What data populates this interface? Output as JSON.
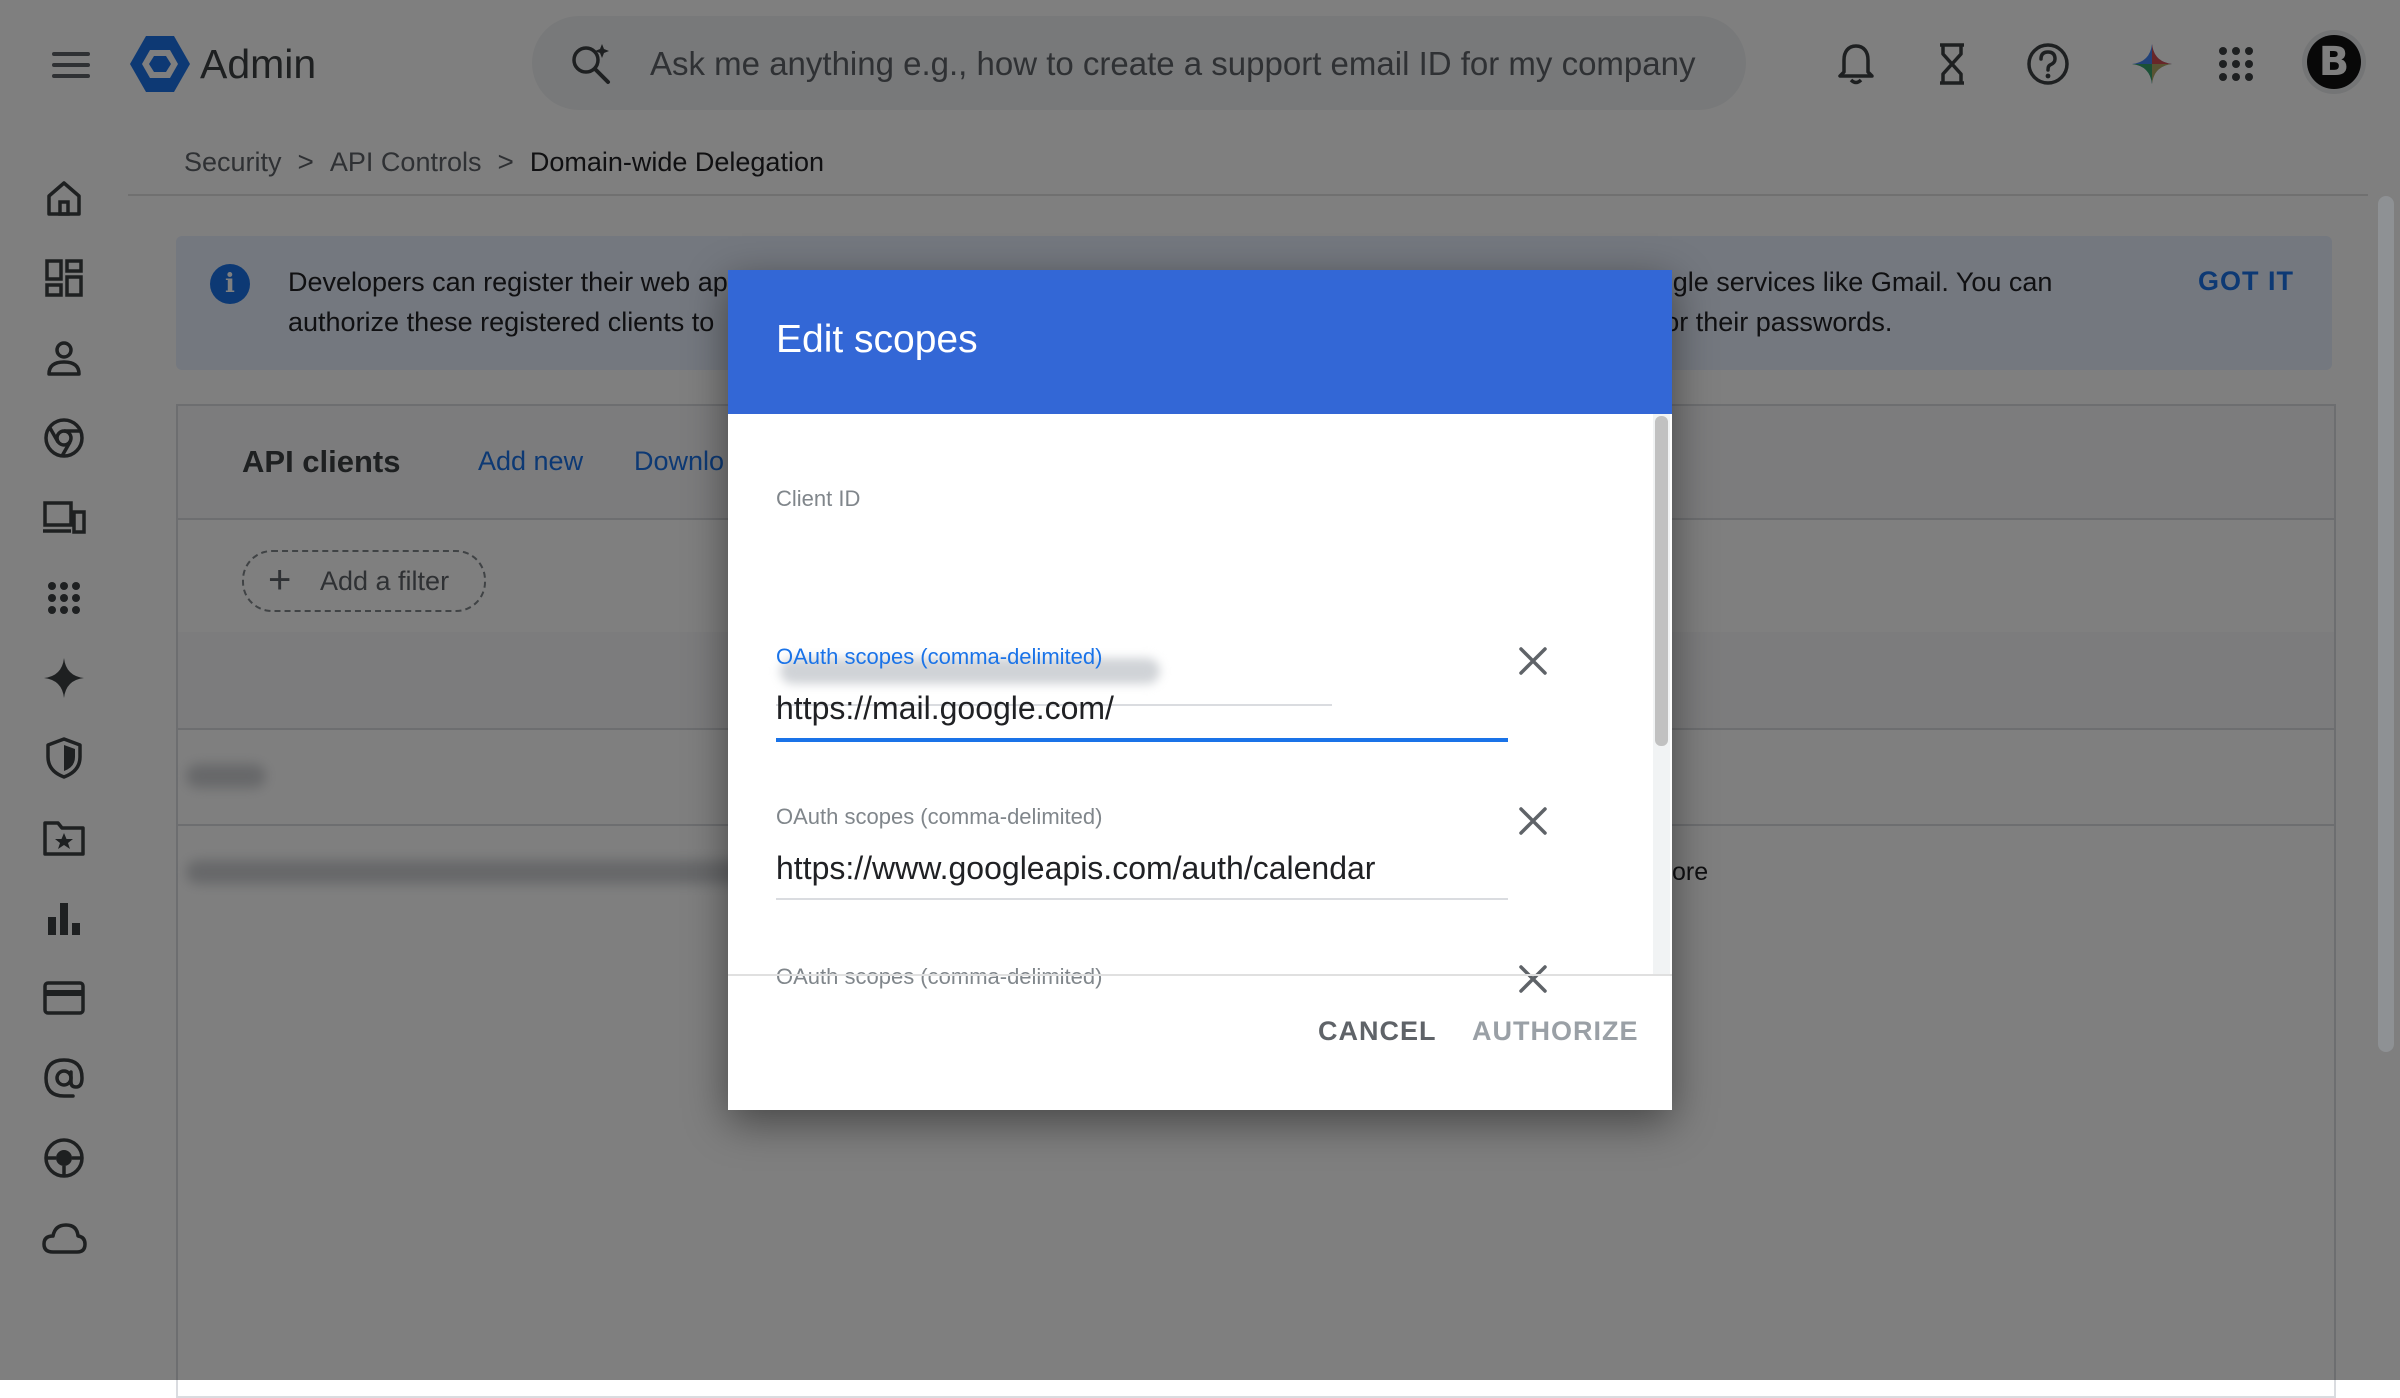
{
  "app": {
    "title": "Admin"
  },
  "search": {
    "placeholder": "Ask me anything e.g., how to create a support email ID for my company"
  },
  "topbar_icons": [
    "bell-icon",
    "hourglass-icon",
    "help-icon",
    "gemini-icon",
    "apps-grid-icon"
  ],
  "avatar": {
    "letter": "B"
  },
  "left_nav": [
    "home-icon",
    "dashboard-icon",
    "person-icon",
    "chrome-icon",
    "devices-icon",
    "apps-icon",
    "sparkle-icon",
    "shield-icon",
    "folder-star-icon",
    "bar-chart-icon",
    "billing-card-icon",
    "at-sign-icon",
    "support-icon",
    "cloud-icon"
  ],
  "breadcrumb": {
    "items": [
      "Security",
      "API Controls",
      "Domain-wide Delegation"
    ],
    "separator": ">"
  },
  "banner": {
    "line1_left": "Developers can register their web ap",
    "line1_right": "ogle services like Gmail. You can",
    "line2_left": "authorize these registered clients to",
    "line2_right": "t or their passwords.",
    "action": "GOT IT"
  },
  "card": {
    "title": "API clients",
    "add_new": "Add new",
    "download": "Downlo",
    "filter_chip": "Add a filter",
    "row_tail": "ore"
  },
  "dialog": {
    "title": "Edit scopes",
    "client_id_label": "Client ID",
    "scopes": [
      {
        "label": "OAuth scopes (comma-delimited)",
        "value": "https://mail.google.com/",
        "focused": true
      },
      {
        "label": "OAuth scopes (comma-delimited)",
        "value": "https://www.googleapis.com/auth/calendar",
        "focused": false
      },
      {
        "label": "OAuth scopes (comma-delimited)",
        "value": "",
        "focused": false
      }
    ],
    "cancel": "CANCEL",
    "authorize": "AUTHORIZE"
  },
  "colors": {
    "header_blue": "#3367d6",
    "accent": "#1a73e8",
    "scrim": "rgba(0,0,0,0.5)"
  }
}
